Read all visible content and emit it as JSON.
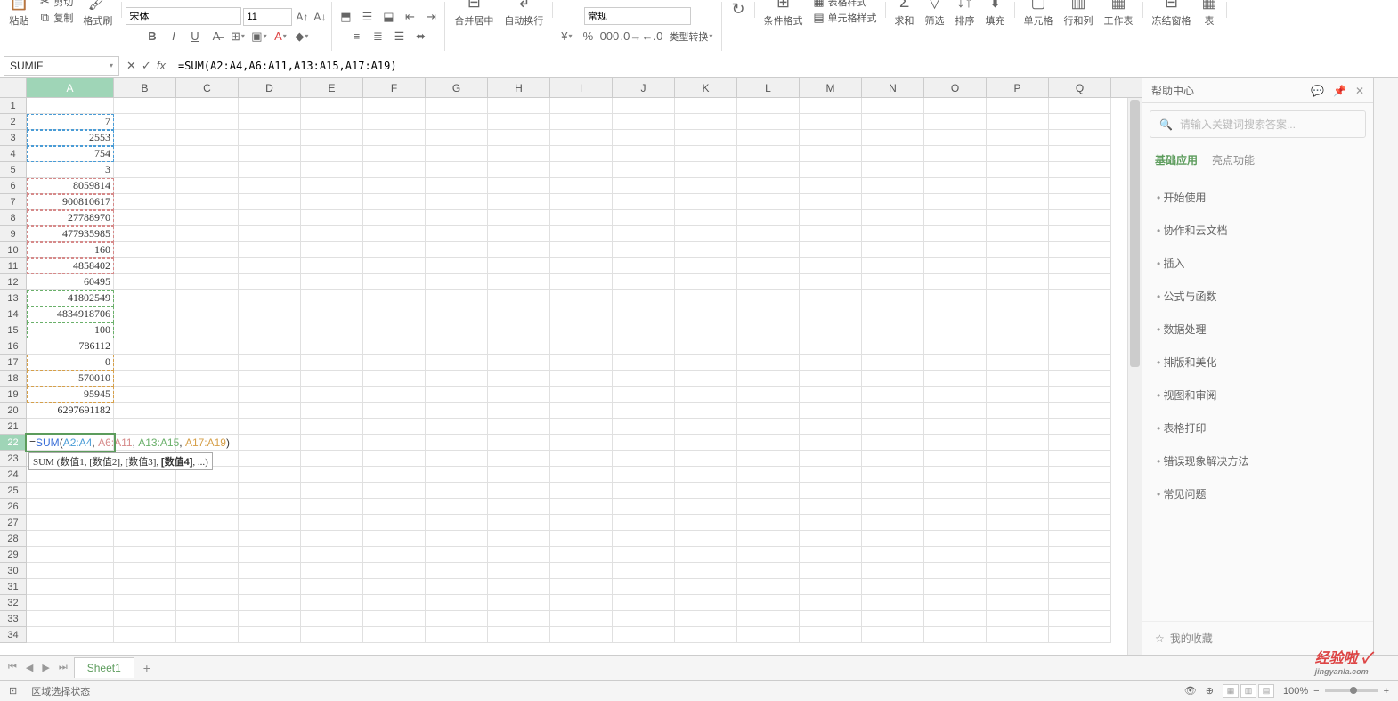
{
  "ribbon": {
    "paste": "粘贴",
    "cut": "剪切",
    "copy": "复制",
    "format_painter": "格式刷",
    "font_name": "宋体",
    "font_size": "11",
    "merge_center": "合并居中",
    "wrap_text": "自动换行",
    "number_format": "常规",
    "type_convert": "类型转换",
    "cond_format": "条件格式",
    "table_style": "表格样式",
    "cell_style": "单元格样式",
    "sum": "求和",
    "filter": "筛选",
    "sort": "排序",
    "fill": "填充",
    "cell": "单元格",
    "row_col": "行和列",
    "worksheet": "工作表",
    "freeze": "冻结窗格",
    "table": "表"
  },
  "namebox": "SUMIF",
  "formula_bar": "=SUM(A2:A4,A6:A11,A13:A15,A17:A19)",
  "columns": [
    "A",
    "B",
    "C",
    "D",
    "E",
    "F",
    "G",
    "H",
    "I",
    "J",
    "K",
    "L",
    "M",
    "N",
    "O",
    "P",
    "Q"
  ],
  "cells": {
    "A2": "7",
    "A3": "2553",
    "A4": "754",
    "A5": "3",
    "A6": "8059814",
    "A7": "900810617",
    "A8": "27788970",
    "A9": "477935985",
    "A10": "160",
    "A11": "4858402",
    "A12": "60495",
    "A13": "41802549",
    "A14": "4834918706",
    "A15": "100",
    "A16": "786112",
    "A17": "0",
    "A18": "570010",
    "A19": "95945",
    "A20": "6297691182"
  },
  "cell_formula": {
    "prefix": "=",
    "fn": "SUM",
    "open": "(",
    "r1": "A2:A4",
    "sep": ", ",
    "r2": "A6:A11",
    "r3": "A13:A15",
    "r4": "A17:A19",
    "close": ")"
  },
  "tooltip": {
    "fn": "SUM",
    "args": " (数值1, [数值2], [数值3], ",
    "bold": "[数值4]",
    "rest": ", ...)"
  },
  "help_panel": {
    "title": "帮助中心",
    "search_placeholder": "请输入关键词搜索答案...",
    "tab_basic": "基础应用",
    "tab_highlight": "亮点功能",
    "items": [
      "开始使用",
      "协作和云文档",
      "插入",
      "公式与函数",
      "数据处理",
      "排版和美化",
      "视图和审阅",
      "表格打印",
      "错误现象解决方法",
      "常见问题"
    ],
    "favorites": "我的收藏"
  },
  "sheet_tab": "Sheet1",
  "status": {
    "left": "区域选择状态",
    "zoom": "100%"
  },
  "watermark": {
    "big": "经验啦 ✓",
    "small": "jingyanla.com"
  },
  "chart_data": {
    "type": "table",
    "note": "Spreadsheet cell values; not a plotted chart",
    "columns": [
      "A"
    ],
    "rows": [
      {
        "row": 2,
        "A": 7
      },
      {
        "row": 3,
        "A": 2553
      },
      {
        "row": 4,
        "A": 754
      },
      {
        "row": 5,
        "A": 3
      },
      {
        "row": 6,
        "A": 8059814
      },
      {
        "row": 7,
        "A": 900810617
      },
      {
        "row": 8,
        "A": 27788970
      },
      {
        "row": 9,
        "A": 477935985
      },
      {
        "row": 10,
        "A": 160
      },
      {
        "row": 11,
        "A": 4858402
      },
      {
        "row": 12,
        "A": 60495
      },
      {
        "row": 13,
        "A": 41802549
      },
      {
        "row": 14,
        "A": 4834918706
      },
      {
        "row": 15,
        "A": 100
      },
      {
        "row": 16,
        "A": 786112
      },
      {
        "row": 17,
        "A": 0
      },
      {
        "row": 18,
        "A": 570010
      },
      {
        "row": 19,
        "A": 95945
      },
      {
        "row": 20,
        "A": 6297691182
      }
    ]
  }
}
